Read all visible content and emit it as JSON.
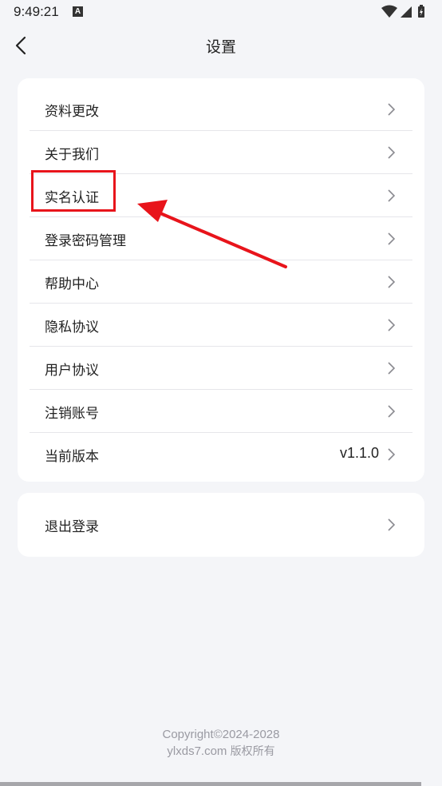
{
  "status_bar": {
    "time": "9:49:21",
    "notification_icon": "A",
    "icons": [
      "wifi-icon",
      "signal-icon",
      "battery-charging-icon"
    ]
  },
  "nav": {
    "back_icon": "chevron-left-icon",
    "title": "设置"
  },
  "settings_items": [
    {
      "label": "资料更改",
      "value": ""
    },
    {
      "label": "关于我们",
      "value": ""
    },
    {
      "label": "实名认证",
      "value": ""
    },
    {
      "label": "登录密码管理",
      "value": ""
    },
    {
      "label": "帮助中心",
      "value": ""
    },
    {
      "label": "隐私协议",
      "value": ""
    },
    {
      "label": "用户协议",
      "value": ""
    },
    {
      "label": "注销账号",
      "value": ""
    },
    {
      "label": "当前版本",
      "value": "v1.1.0"
    }
  ],
  "logout": {
    "label": "退出登录"
  },
  "annotation": {
    "highlighted_item": "实名认证",
    "color": "#e8141b"
  },
  "footer": {
    "copyright_line1": "Copyright©2024-2028",
    "copyright_line2_domain": "ylxds7.com",
    "copyright_line2_rights": "版权所有"
  },
  "colors": {
    "background": "#f4f5f8",
    "card": "#ffffff",
    "text": "#222222",
    "footer_text": "#9a9aa2"
  }
}
